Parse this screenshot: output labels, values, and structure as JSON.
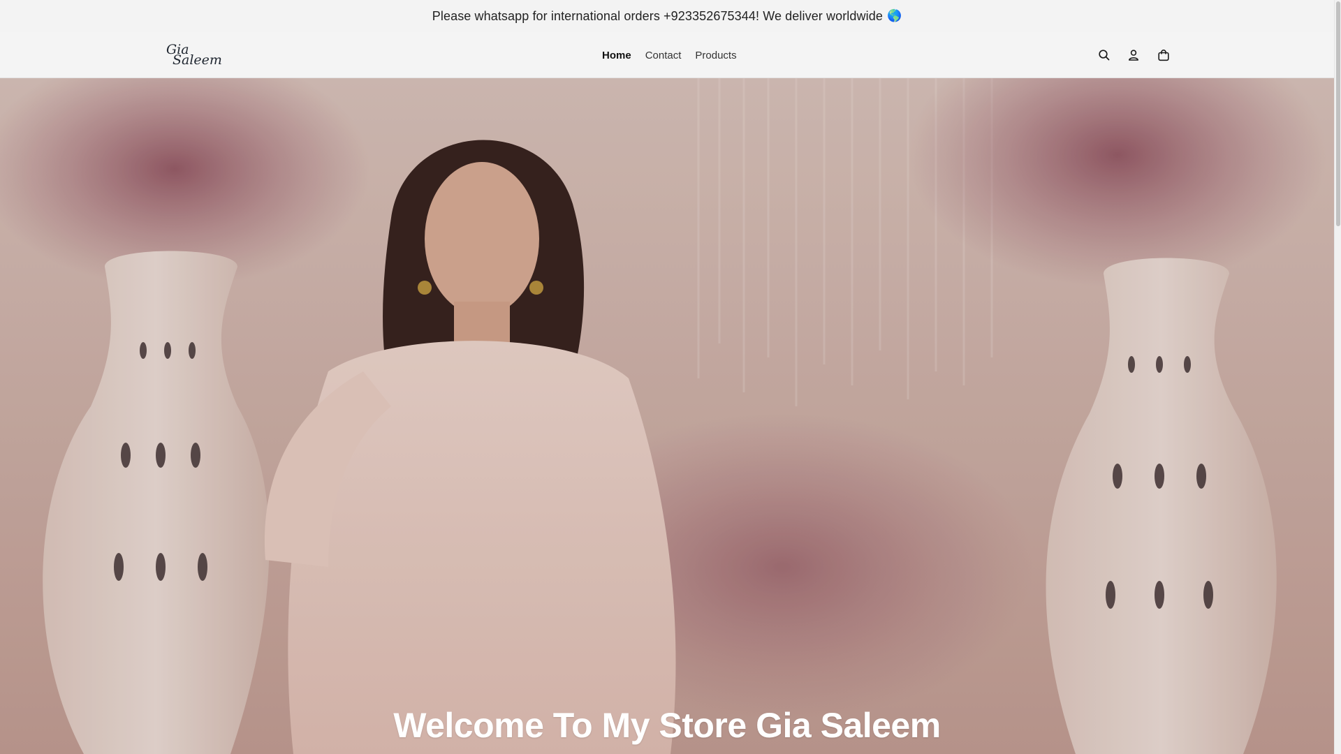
{
  "announcement": {
    "text": "Please whatsapp for international orders +923352675344! We deliver worldwide",
    "globe": "🌎"
  },
  "header": {
    "logo_line1": "Gia",
    "logo_line2": "Saleem",
    "nav": [
      {
        "label": "Home",
        "active": true
      },
      {
        "label": "Contact",
        "active": false
      },
      {
        "label": "Products",
        "active": false
      }
    ],
    "icons": [
      "search-icon",
      "account-icon",
      "cart-icon"
    ]
  },
  "hero": {
    "title": "Welcome To My Store Gia Saleem"
  },
  "colors": {
    "text": "#222222",
    "header_bg": "#f4f4f4",
    "hero_text": "#ffffff"
  }
}
